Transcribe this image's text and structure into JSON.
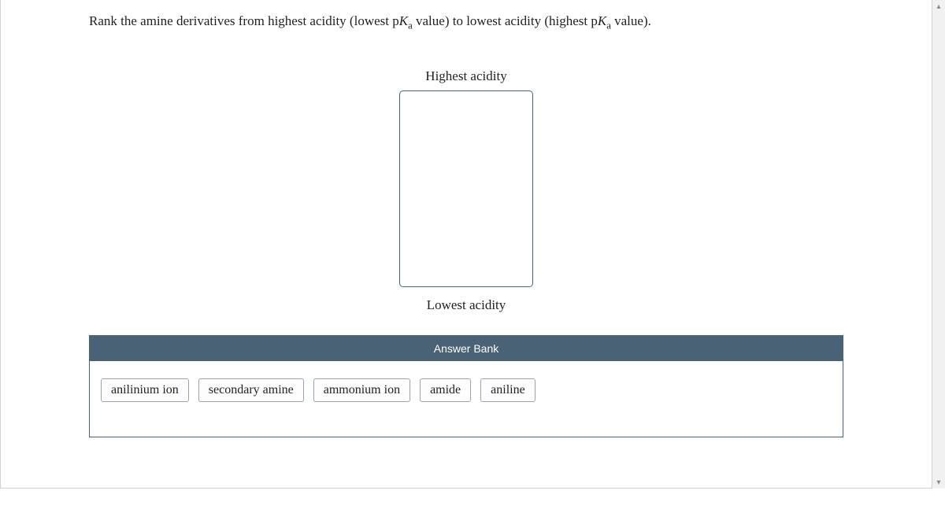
{
  "question": {
    "prefix": "Rank the amine derivatives from highest acidity (lowest p",
    "K": "K",
    "sub": "a",
    "mid": " value) to lowest acidity (highest p",
    "suffix": " value)."
  },
  "labels": {
    "highest": "Highest acidity",
    "lowest": "Lowest acidity",
    "bank": "Answer Bank"
  },
  "options": [
    "anilinium ion",
    "secondary amine",
    "ammonium ion",
    "amide",
    "aniline"
  ]
}
